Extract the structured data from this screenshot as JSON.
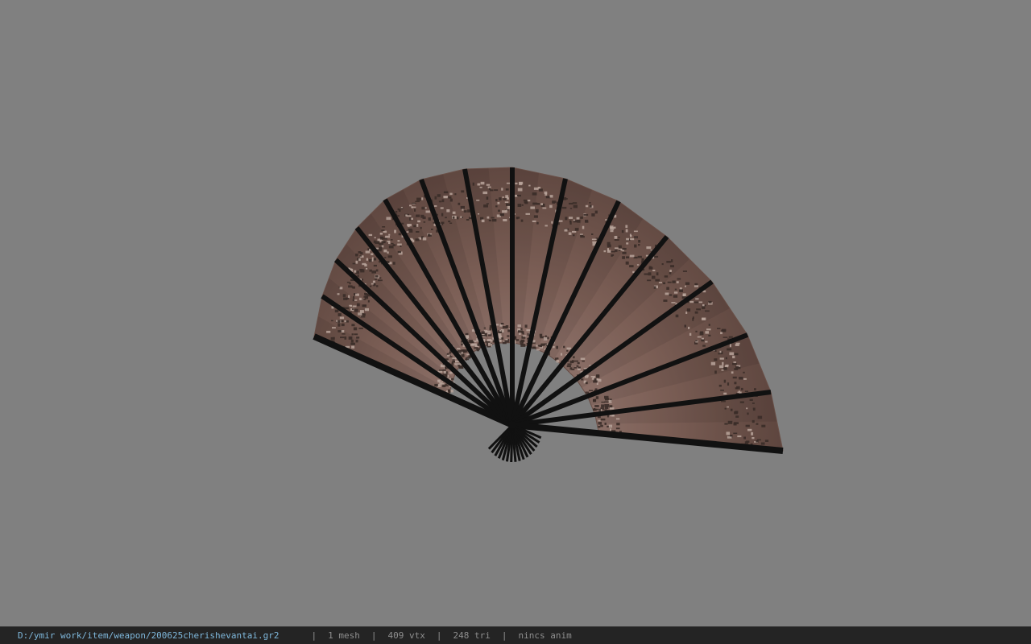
{
  "viewport": {
    "background_color": "#808080",
    "model": {
      "object": "folding-fan",
      "rib_color": "#111111",
      "leaf_color": "#6a5048",
      "lace_color": "#3a2c28"
    }
  },
  "status_bar": {
    "file_path": "D:/ymir work/item/weapon/200625cherishevantai.gr2",
    "separator": "|",
    "mesh_count": "1 mesh",
    "vertex_count": "409 vtx",
    "triangle_count": "248 tri",
    "animation": "nincs anim"
  }
}
